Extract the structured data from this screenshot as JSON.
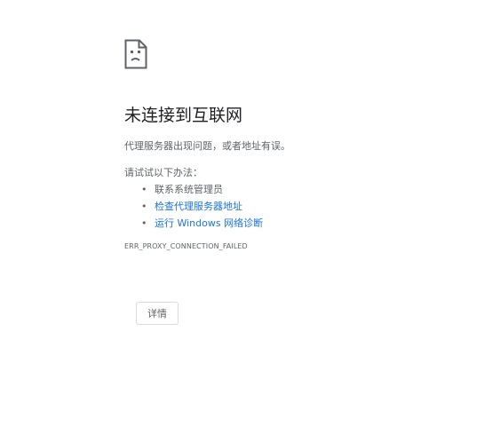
{
  "error_page": {
    "icon": "sad-page-icon",
    "heading": "未连接到互联网",
    "description": "代理服务器出现问题，或者地址有误。",
    "try_title": "请试试以下办法：",
    "suggestions": [
      {
        "label": "联系系统管理员",
        "is_link": false
      },
      {
        "label": "检查代理服务器地址",
        "is_link": true
      },
      {
        "label": "运行 Windows 网络诊断",
        "is_link": true
      }
    ],
    "error_code": "ERR_PROXY_CONNECTION_FAILED",
    "details_button": "详情"
  },
  "colors": {
    "heading": "#202124",
    "text": "#5f6368",
    "link": "#1a73e8",
    "border": "#dadce0"
  }
}
